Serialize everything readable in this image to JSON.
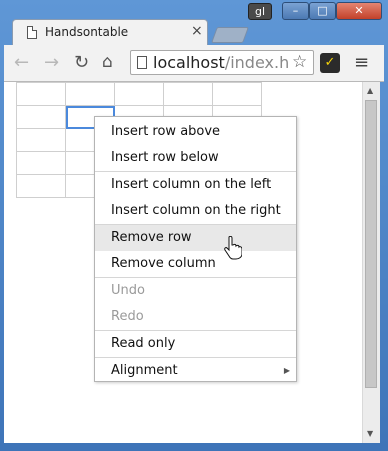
{
  "window": {
    "tab_title": "Handsontable",
    "tab_close": "×",
    "user_badge": "gl",
    "min_label": "–",
    "max_label": "□",
    "close_label": "✕"
  },
  "toolbar": {
    "back": "←",
    "forward": "→",
    "reload": "↻",
    "home": "⌂",
    "url_host": "localhost",
    "url_path": "/index.h",
    "star": "☆",
    "ext": "✓",
    "menu": "≡"
  },
  "context_menu": {
    "items": [
      {
        "label": "Insert row above"
      },
      {
        "label": "Insert row below"
      },
      {
        "label": "Insert column on the left"
      },
      {
        "label": "Insert column on the right"
      },
      {
        "label": "Remove row"
      },
      {
        "label": "Remove column"
      },
      {
        "label": "Undo"
      },
      {
        "label": "Redo"
      },
      {
        "label": "Read only"
      },
      {
        "label": "Alignment"
      }
    ],
    "submenu_arrow": "▶"
  },
  "scrollbar": {
    "up": "▲",
    "down": "▼"
  },
  "icons": {
    "tab": "document-icon",
    "page": "page-icon",
    "cursor": "hand-pointer-icon"
  }
}
